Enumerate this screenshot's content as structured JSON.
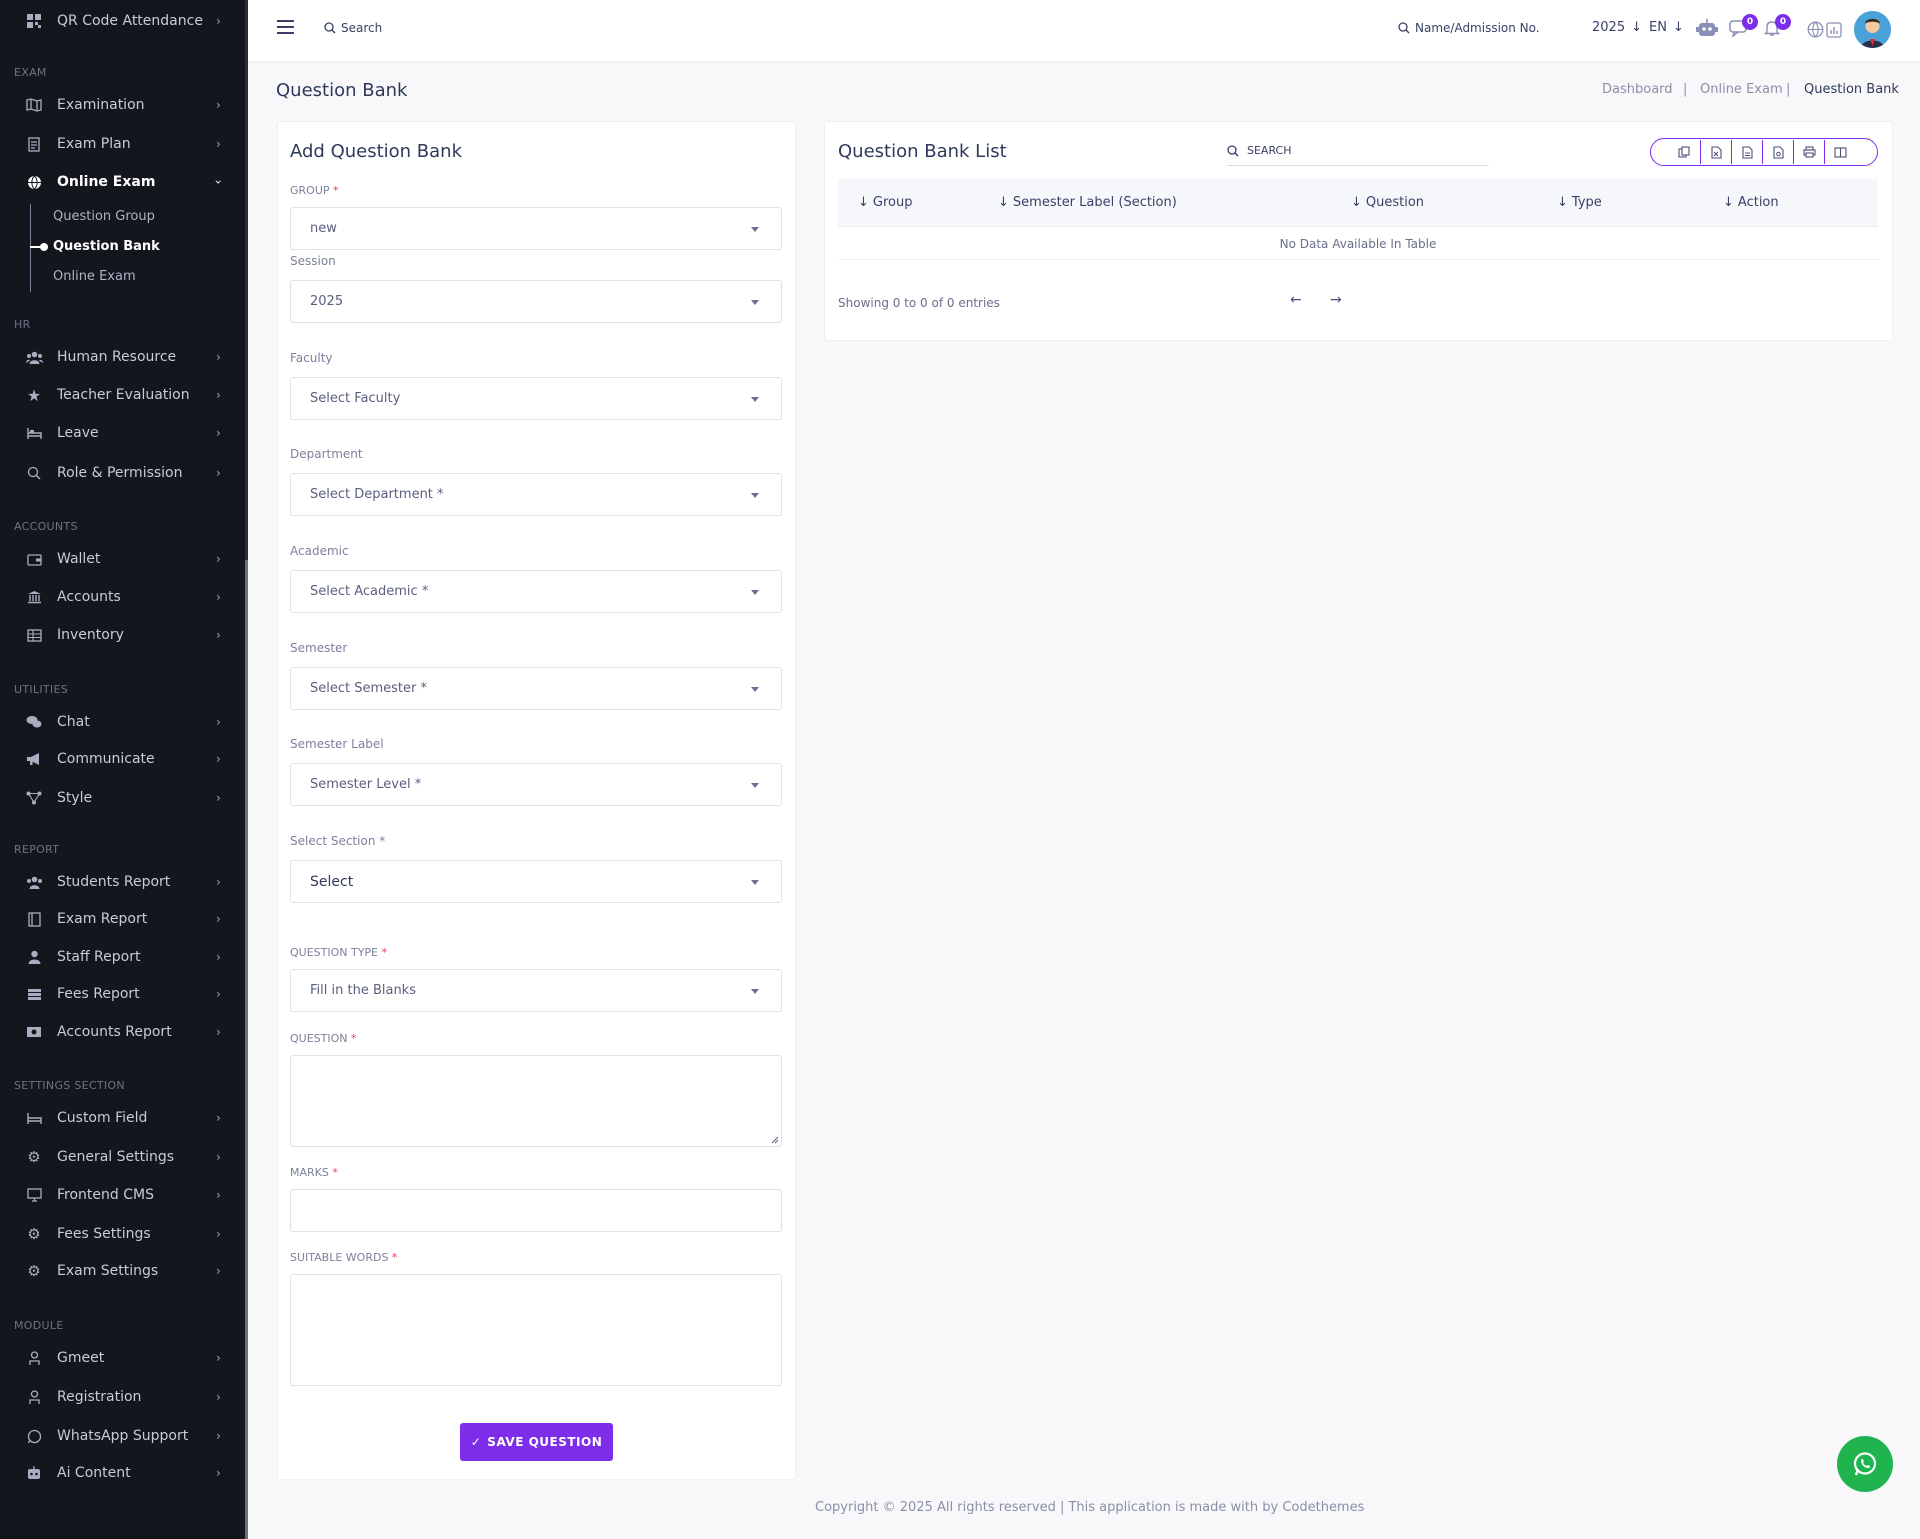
{
  "sidebar": {
    "top_item": "QR Code Attendance",
    "sections": {
      "exam": "EXAM",
      "hr": "HR",
      "accounts": "ACCOUNTS",
      "utilities": "UTILITIES",
      "report": "REPORT",
      "settings": "SETTINGS SECTION",
      "module": "MODULE"
    },
    "items": {
      "examination": "Examination",
      "exam_plan": "Exam Plan",
      "online_exam": "Online Exam",
      "human_resource": "Human Resource",
      "teacher_evaluation": "Teacher Evaluation",
      "leave": "Leave",
      "role_permission": "Role & Permission",
      "wallet": "Wallet",
      "accounts": "Accounts",
      "inventory": "Inventory",
      "chat": "Chat",
      "communicate": "Communicate",
      "style": "Style",
      "students_report": "Students Report",
      "exam_report": "Exam Report",
      "staff_report": "Staff Report",
      "fees_report": "Fees Report",
      "accounts_report": "Accounts Report",
      "custom_field": "Custom Field",
      "general_settings": "General Settings",
      "frontend_cms": "Frontend CMS",
      "fees_settings": "Fees Settings",
      "exam_settings": "Exam Settings",
      "gmeet": "Gmeet",
      "registration": "Registration",
      "whatsapp_support": "WhatsApp Support",
      "ai_content": "Ai Content"
    },
    "sub_items": {
      "question_group": "Question Group",
      "question_bank": "Question Bank",
      "online_exam": "Online Exam"
    }
  },
  "topbar": {
    "search_label": "Search",
    "student_search": "Name/Admission No.",
    "year": "2025",
    "lang": "EN",
    "chat_badge": "0",
    "notif_badge": "0"
  },
  "page": {
    "title": "Question Bank",
    "breadcrumb": [
      "Dashboard",
      "Online Exam",
      "Question Bank"
    ],
    "breadcrumb_sep": "|"
  },
  "form": {
    "title": "Add Question Bank",
    "group_label": "GROUP",
    "group_value": "new",
    "session_label": "Session",
    "session_value": "2025",
    "faculty_label": "Faculty",
    "faculty_value": "Select Faculty",
    "department_label": "Department",
    "department_value": "Select Department *",
    "academic_label": "Academic",
    "academic_value": "Select Academic *",
    "semester_label": "Semester",
    "semester_value": "Select Semester *",
    "semester_label_label": "Semester Label",
    "semester_label_value": "Semester Level *",
    "section_label": "Select Section *",
    "section_value": "Select",
    "question_type_label": "QUESTION TYPE",
    "question_type_value": "Fill in the Blanks",
    "question_label": "QUESTION",
    "marks_label": "MARKS",
    "suitable_words_label": "SUITABLE WORDS",
    "required_mark": "*",
    "save_button": "SAVE QUESTION"
  },
  "list": {
    "title": "Question Bank List",
    "search_placeholder": "SEARCH",
    "columns": [
      "Group",
      "Semester Label (Section)",
      "Question",
      "Type",
      "Action"
    ],
    "empty_text": "No Data Available In Table",
    "showing": "Showing 0 to 0 of 0 entries"
  },
  "footer": {
    "text": "Copyright © 2025 All rights reserved | This application is made with by Codethemes"
  },
  "colors": {
    "sidebar_bg": "#14161d",
    "accent": "#7e2eea",
    "whatsapp": "#1fb44e",
    "required": "#e5415a"
  }
}
